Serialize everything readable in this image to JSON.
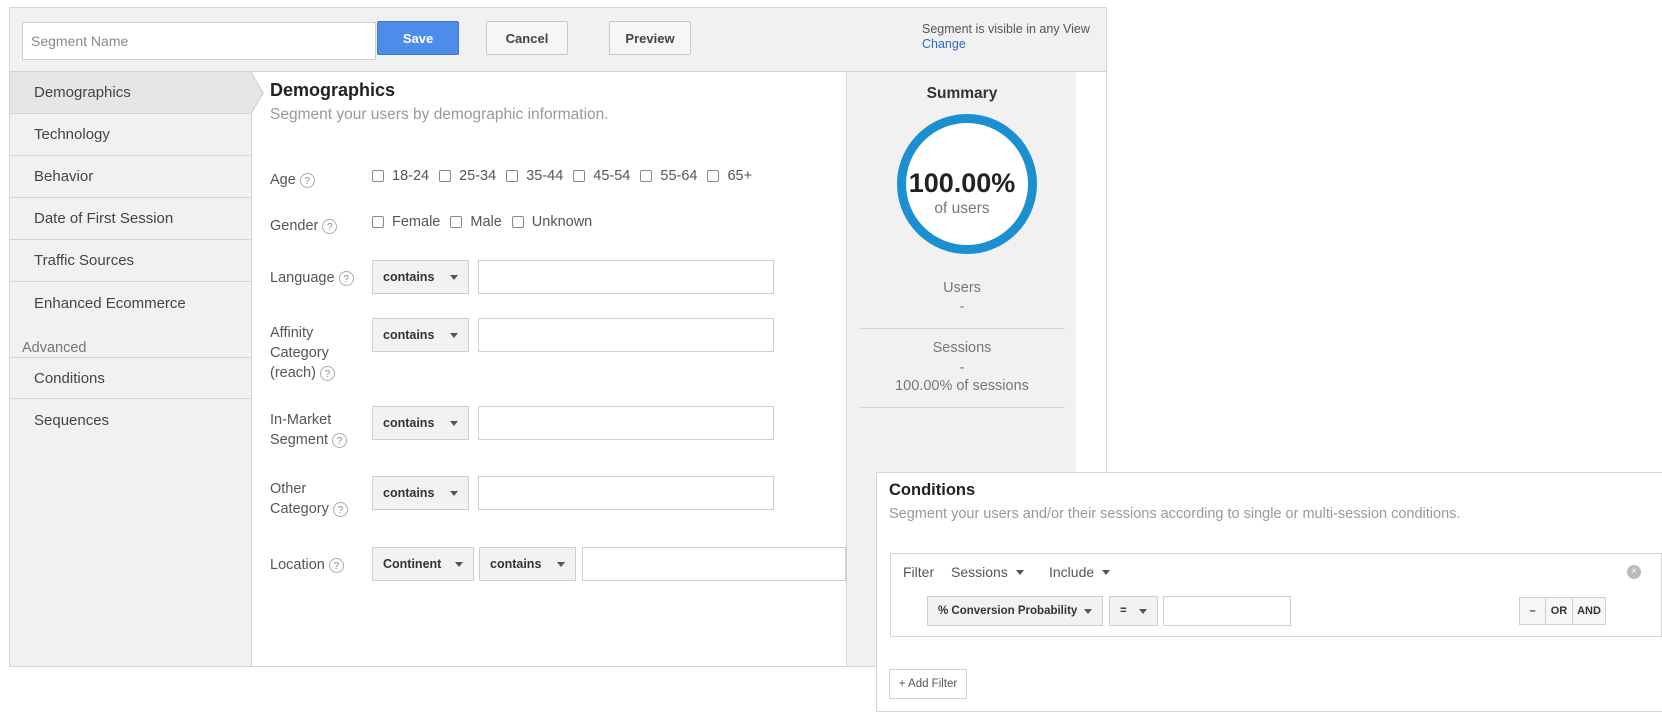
{
  "toolbar": {
    "segment_name_placeholder": "Segment Name",
    "save_label": "Save",
    "cancel_label": "Cancel",
    "preview_label": "Preview",
    "visibility_text": "Segment is visible in any View",
    "visibility_link": "Change"
  },
  "sidebar": {
    "items": [
      {
        "label": "Demographics"
      },
      {
        "label": "Technology"
      },
      {
        "label": "Behavior"
      },
      {
        "label": "Date of First Session"
      },
      {
        "label": "Traffic Sources"
      },
      {
        "label": "Enhanced Ecommerce"
      }
    ],
    "advanced_header": "Advanced",
    "advanced_items": [
      {
        "label": "Conditions"
      },
      {
        "label": "Sequences"
      }
    ]
  },
  "demographics": {
    "title": "Demographics",
    "subtitle": "Segment your users by demographic information.",
    "age": {
      "label": "Age",
      "options": [
        "18-24",
        "25-34",
        "35-44",
        "45-54",
        "55-64",
        "65+"
      ]
    },
    "gender": {
      "label": "Gender",
      "options": [
        "Female",
        "Male",
        "Unknown"
      ]
    },
    "help_glyph": "?",
    "language": {
      "label": "Language",
      "operator": "contains"
    },
    "affinity": {
      "label_lines": [
        "Affinity",
        "Category",
        "(reach)"
      ],
      "operator": "contains"
    },
    "in_market": {
      "label_lines": [
        "In-Market",
        "Segment"
      ],
      "operator": "contains"
    },
    "other": {
      "label_lines": [
        "Other",
        "Category"
      ],
      "operator": "contains"
    },
    "location": {
      "label": "Location",
      "dimension": "Continent",
      "operator": "contains"
    }
  },
  "summary": {
    "title": "Summary",
    "percent": "100.00%",
    "percent_sub": "of users",
    "users_label": "Users",
    "users_value": "-",
    "sessions_label": "Sessions",
    "sessions_value": "-",
    "sessions_pct": "100.00% of sessions",
    "ring_fraction": 1.0,
    "ring_color": "#1b8fd0"
  },
  "conditions": {
    "title": "Conditions",
    "subtitle": "Segment your users and/or their sessions according to single or multi-session conditions.",
    "filter_label": "Filter",
    "scope": "Sessions",
    "mode": "Include",
    "close_glyph": "×",
    "dimension": "% Conversion Probability",
    "operator": "=",
    "minus_label": "–",
    "or_label": "OR",
    "and_label": "AND",
    "add_filter_label": "+ Add Filter"
  },
  "colors": {
    "accent": "#4b8de8",
    "ring": "#1b8fd0"
  }
}
